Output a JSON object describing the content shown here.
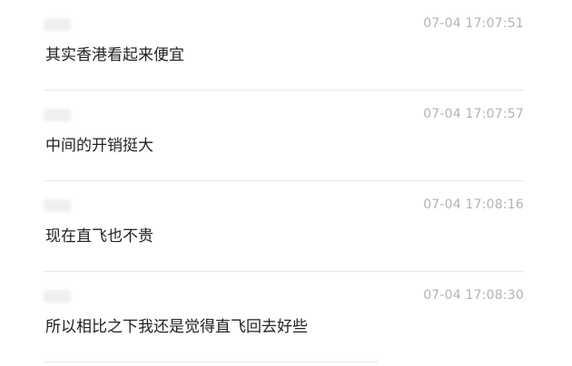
{
  "messages": [
    {
      "time": "07-04 17:07:51",
      "text": "其实香港看起来便宜"
    },
    {
      "time": "07-04 17:07:57",
      "text": "中间的开销挺大"
    },
    {
      "time": "07-04 17:08:16",
      "text": "现在直飞也不贵"
    },
    {
      "time": "07-04 17:08:30",
      "text": "所以相比之下我还是觉得直飞回去好些"
    }
  ]
}
